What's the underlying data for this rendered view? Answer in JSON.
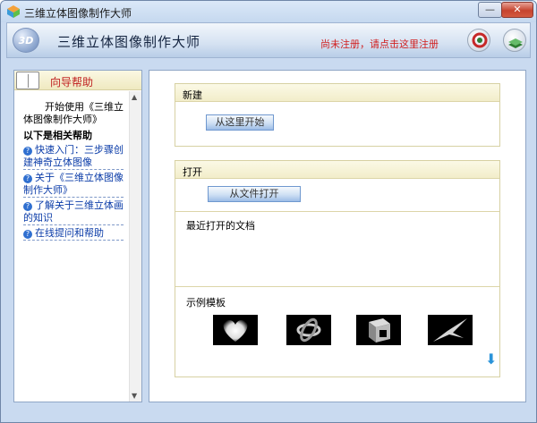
{
  "window": {
    "title": "三维立体图像制作大师",
    "min_label": "—",
    "close_label": "✕"
  },
  "header": {
    "logo_text": "3D",
    "title": "三维立体图像制作大师",
    "register_link": "尚未注册，请点击这里注册"
  },
  "guide": {
    "title": "向导帮助",
    "intro": "开始使用《三维立体图像制作大师》",
    "subheading": "以下是相关帮助",
    "links": [
      {
        "label": "快速入门：三步骤创建神奇立体图像"
      },
      {
        "label": "关于《三维立体图像制作大师》"
      },
      {
        "label": "了解关于三维立体画的知识"
      },
      {
        "label": "在线提问和帮助"
      }
    ]
  },
  "new_section": {
    "title": "新建",
    "button": "从这里开始"
  },
  "open_section": {
    "title": "打开",
    "button": "从文件打开",
    "recent_label": "最近打开的文档",
    "templates_label": "示例模板"
  },
  "templates": [
    {
      "icon": "heart"
    },
    {
      "icon": "knot"
    },
    {
      "icon": "cube"
    },
    {
      "icon": "bird"
    }
  ],
  "colors": {
    "accent": "#c9daf0",
    "link": "#0b3ca8",
    "register": "#d11f1f",
    "section_head": "#f2edca"
  }
}
